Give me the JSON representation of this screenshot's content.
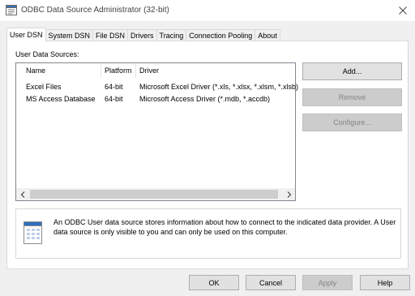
{
  "window": {
    "title": "ODBC Data Source Administrator (32-bit)"
  },
  "tabs": [
    {
      "label": "User DSN",
      "active": true
    },
    {
      "label": "System DSN",
      "active": false
    },
    {
      "label": "File DSN",
      "active": false
    },
    {
      "label": "Drivers",
      "active": false
    },
    {
      "label": "Tracing",
      "active": false
    },
    {
      "label": "Connection Pooling",
      "active": false
    },
    {
      "label": "About",
      "active": false
    }
  ],
  "user_dsn": {
    "section_label": "User Data Sources:",
    "columns": [
      "Name",
      "Platform",
      "Driver"
    ],
    "rows": [
      {
        "name": "Excel Files",
        "platform": "64-bit",
        "driver": "Microsoft Excel Driver (*.xls, *.xlsx, *.xlsm, *.xlsb)"
      },
      {
        "name": "MS Access Database",
        "platform": "64-bit",
        "driver": "Microsoft Access Driver (*.mdb, *.accdb)"
      }
    ],
    "buttons": {
      "add": "Add...",
      "remove": "Remove",
      "configure": "Configure..."
    },
    "info_text": "An ODBC User data source stores information about how to connect to the indicated data provider.  A User data source is only visible to you and can only be used on this computer."
  },
  "footer": {
    "ok": "OK",
    "cancel": "Cancel",
    "apply": "Apply",
    "help": "Help"
  },
  "icons": {
    "app": "odbc-admin-icon",
    "close": "close-icon",
    "info": "data-source-document-icon",
    "scroll_left": "chevron-left-icon",
    "scroll_right": "chevron-right-icon"
  },
  "colors": {
    "window_bg": "#f0f0f0",
    "panel_bg": "#ffffff",
    "button_bg": "#e1e1e1",
    "disabled_text": "#838383"
  }
}
